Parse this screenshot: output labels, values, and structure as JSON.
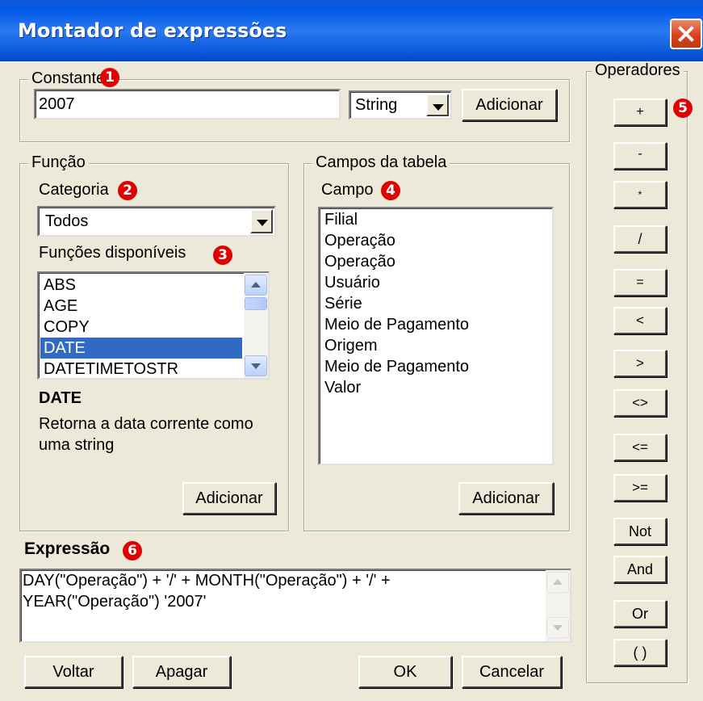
{
  "window": {
    "title": "Montador de expressões"
  },
  "constante": {
    "group_title": "Constante",
    "badge": "1",
    "value": "2007",
    "type_selected": "String",
    "add_label": "Adicionar"
  },
  "funcao": {
    "group_title": "Função",
    "categoria_label": "Categoria",
    "badge_categoria": "2",
    "categoria_value": "Todos",
    "funcoes_label": "Funções disponíveis",
    "badge_funcoes": "3",
    "items": [
      "ABS",
      "AGE",
      "COPY",
      "DATE",
      "DATETIMETOSTR"
    ],
    "selected_index": 3,
    "selected_name": "DATE",
    "description_line1": "Retorna a data corrente como",
    "description_line2": "uma string",
    "add_label": "Adicionar"
  },
  "campos": {
    "group_title": "Campos da tabela",
    "campo_label": "Campo",
    "badge": "4",
    "items": [
      "Filial",
      "Operação",
      "Operação",
      "Usuário",
      "Série",
      "Meio de Pagamento",
      "Origem",
      "Meio de Pagamento",
      "Valor"
    ],
    "add_label": "Adicionar"
  },
  "operadores": {
    "group_title": "Operadores",
    "badge": "5",
    "items": [
      "+",
      "-",
      "*",
      "/",
      "=",
      "<",
      ">",
      "<>",
      "<=",
      ">=",
      "Not",
      "And",
      "Or",
      "( )"
    ]
  },
  "expressao": {
    "label": "Expressão",
    "badge": "6",
    "line1": "DAY(\"Operação\") + '/' + MONTH(\"Operação\") + '/' +",
    "line2": "YEAR(\"Operação\") '2007'"
  },
  "footer": {
    "voltar": "Voltar",
    "apagar": "Apagar",
    "ok": "OK",
    "cancelar": "Cancelar"
  }
}
